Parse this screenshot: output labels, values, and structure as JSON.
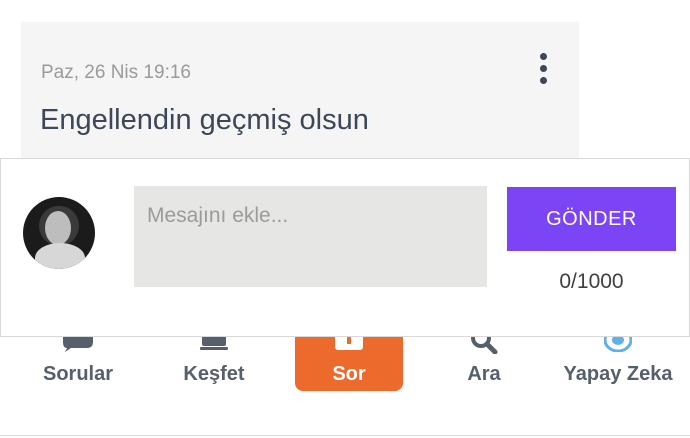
{
  "message": {
    "date": "Paz, 26 Nis 19:16",
    "text": "Engellendin geçmiş olsun"
  },
  "compose": {
    "placeholder": "Mesajını ekle...",
    "send_label": "GÖNDER",
    "counter": "0/1000"
  },
  "nav": {
    "items": [
      {
        "label": "Sorular",
        "icon": "chat-bubble-icon"
      },
      {
        "label": "Keşfet",
        "icon": "explore-icon"
      },
      {
        "label": "Sor",
        "icon": "ask-icon",
        "active": true
      },
      {
        "label": "Ara",
        "icon": "search-icon"
      },
      {
        "label": "Yapay Zeka",
        "icon": "ai-icon"
      }
    ]
  },
  "colors": {
    "accent_purple": "#7b45f5",
    "accent_orange": "#ec6a2c",
    "card_bg": "#f5f5f5",
    "text_dark": "#3c4757"
  }
}
